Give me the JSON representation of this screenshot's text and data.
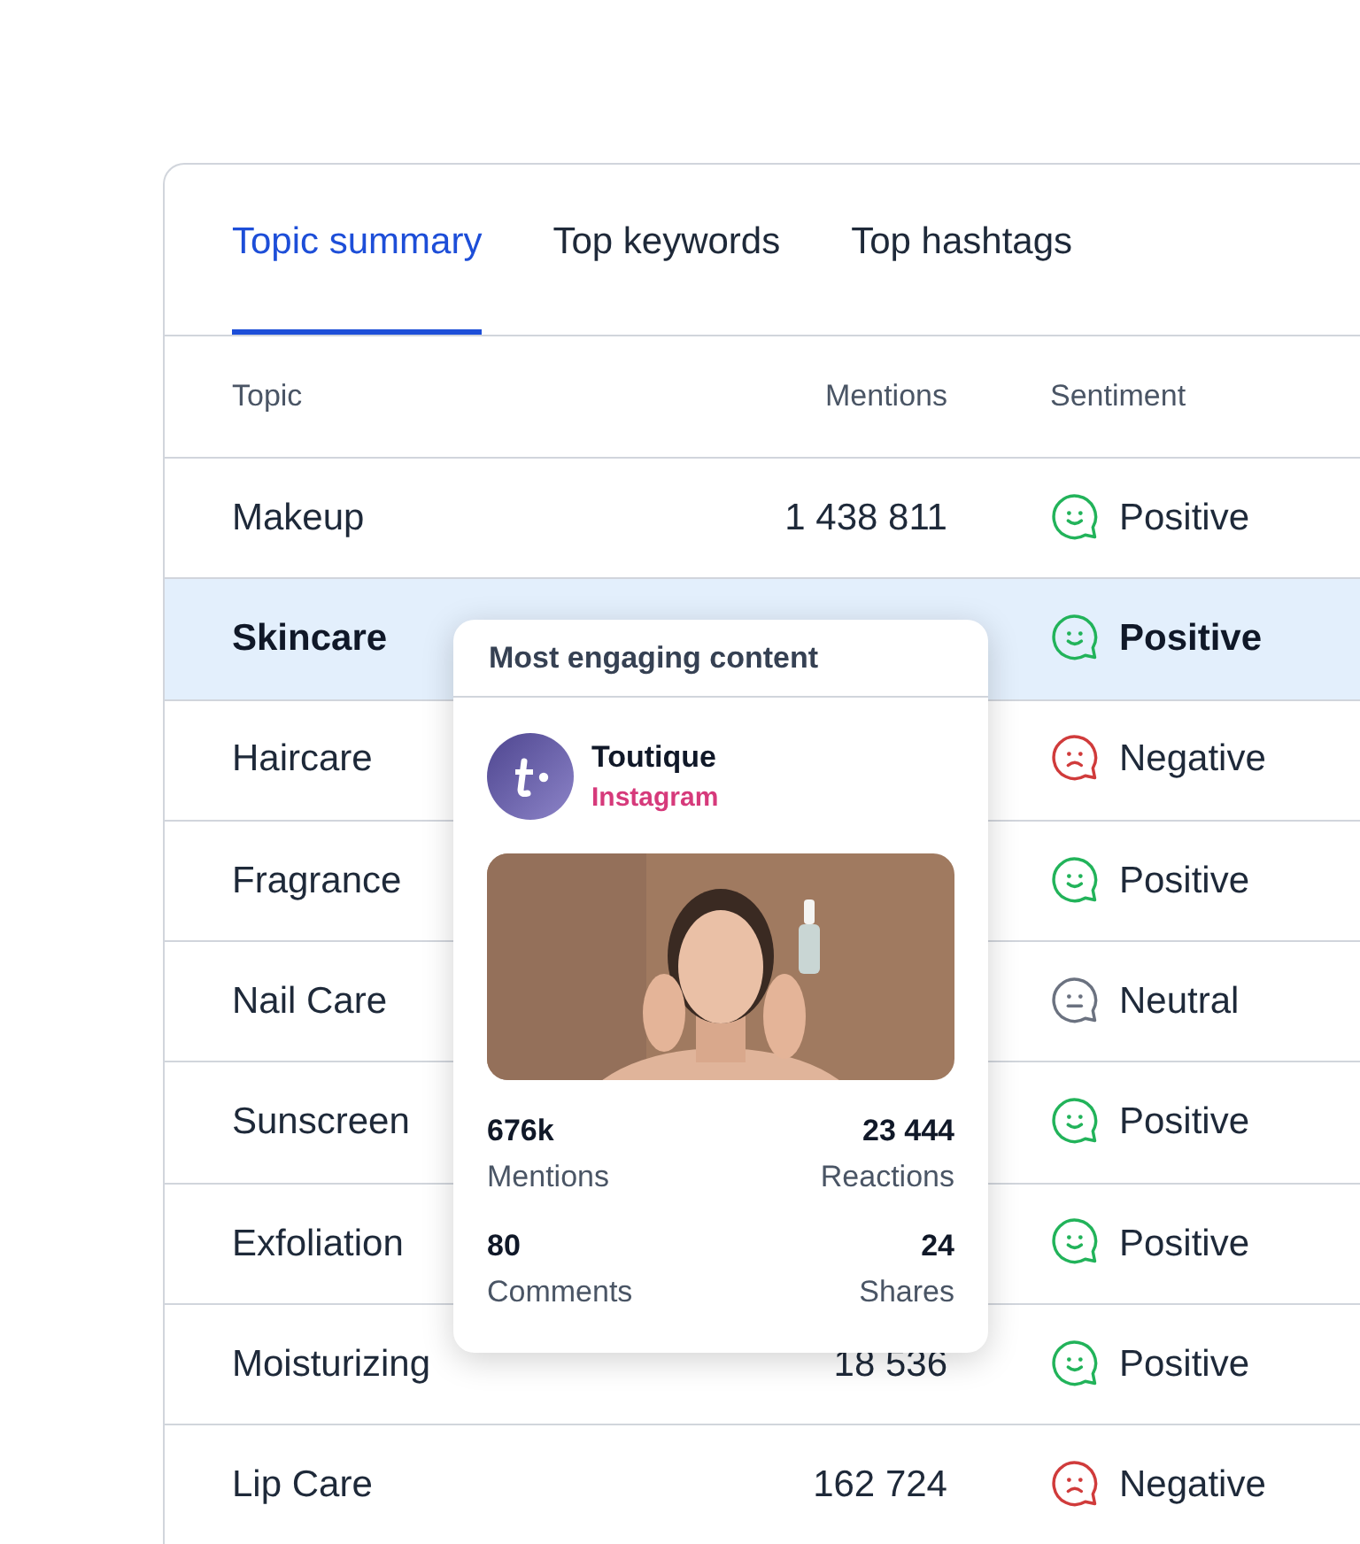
{
  "tabs": [
    {
      "label": "Topic summary",
      "selected": true
    },
    {
      "label": "Top keywords",
      "selected": false
    },
    {
      "label": "Top hashtags",
      "selected": false
    }
  ],
  "table": {
    "columns": [
      "Topic",
      "Mentions",
      "Sentiment"
    ],
    "rows": [
      {
        "topic": "Makeup",
        "mentions": "1 438 811",
        "sentiment": {
          "kind": "positive",
          "label": "Positive"
        },
        "selected": false
      },
      {
        "topic": "Skincare",
        "sentiment": {
          "kind": "positive",
          "label": "Positive"
        },
        "selected": true
      },
      {
        "topic": "Haircare",
        "sentiment": {
          "kind": "negative",
          "label": "Negative"
        },
        "selected": false
      },
      {
        "topic": "Fragrance",
        "sentiment": {
          "kind": "positive",
          "label": "Positive"
        },
        "selected": false
      },
      {
        "topic": "Nail Care",
        "sentiment": {
          "kind": "neutral",
          "label": "Neutral"
        },
        "selected": false
      },
      {
        "topic": "Sunscreen",
        "sentiment": {
          "kind": "positive",
          "label": "Positive"
        },
        "selected": false
      },
      {
        "topic": "Exfoliation",
        "sentiment": {
          "kind": "positive",
          "label": "Positive"
        },
        "selected": false
      },
      {
        "topic": "Moisturizing",
        "mentions": "18 536",
        "sentiment": {
          "kind": "positive",
          "label": "Positive"
        },
        "selected": false
      },
      {
        "topic": "Lip Care",
        "mentions": "162 724",
        "sentiment": {
          "kind": "negative",
          "label": "Negative"
        },
        "selected": false
      }
    ]
  },
  "popup": {
    "title": "Most engaging content",
    "account": "Toutique",
    "platform": "Instagram",
    "stats": [
      {
        "value": "676k",
        "label": "Mentions"
      },
      {
        "value": "23 444",
        "label": "Reactions"
      },
      {
        "value": "80",
        "label": "Comments"
      },
      {
        "value": "24",
        "label": "Shares"
      }
    ]
  }
}
